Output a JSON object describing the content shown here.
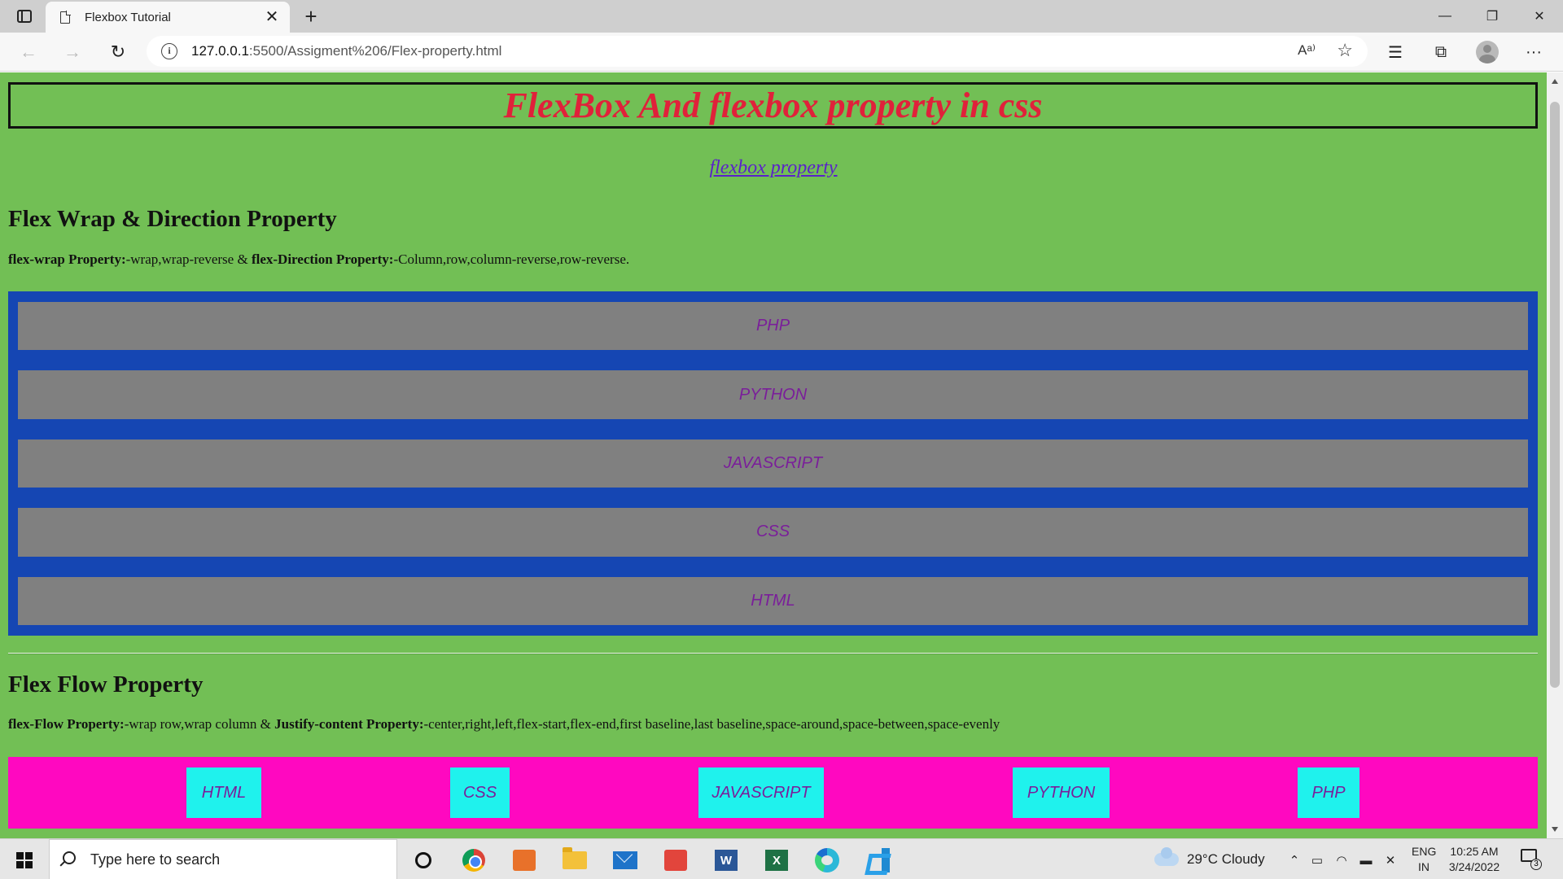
{
  "browser": {
    "tab_title": "Flexbox Tutorial",
    "url_host": "127.0.0.1",
    "url_path": ":5500/Assigment%206/Flex-property.html",
    "read_aloud_icon": "Aᵃ⁾"
  },
  "page": {
    "heading": "FlexBox And flexbox property in css",
    "link_text": "flexbox property",
    "section1": {
      "title": "Flex Wrap & Direction Property",
      "desc_b1": "flex-wrap Property:",
      "desc_t1": "-wrap,wrap-reverse & ",
      "desc_b2": "flex-Direction Property:",
      "desc_t2": "-Column,row,column-reverse,row-reverse.",
      "items": [
        "PHP",
        "PYTHON",
        "JAVASCRIPT",
        "CSS",
        "HTML"
      ]
    },
    "section2": {
      "title": "Flex Flow Property",
      "desc_b1": "flex-Flow Property:",
      "desc_t1": "-wrap row,wrap column & ",
      "desc_b2": "Justify-content Property:",
      "desc_t2": "-center,right,left,flex-start,flex-end,first baseline,last baseline,space-around,space-between,space-evenly",
      "items": [
        "HTML",
        "CSS",
        "JAVASCRIPT",
        "PYTHON",
        "PHP"
      ]
    },
    "colors": {
      "background": "#72bf55",
      "heading": "#e0213a",
      "column_container": "#1546b3",
      "column_item": "#808080",
      "row_container": "#ff08c0",
      "row_item": "#1ff2ed",
      "item_text": "#7a1e9a"
    }
  },
  "taskbar": {
    "search_placeholder": "Type here to search",
    "weather": "29°C  Cloudy",
    "lang_1": "ENG",
    "lang_2": "IN",
    "time": "10:25 AM",
    "date": "3/24/2022",
    "notification_count": "3"
  }
}
